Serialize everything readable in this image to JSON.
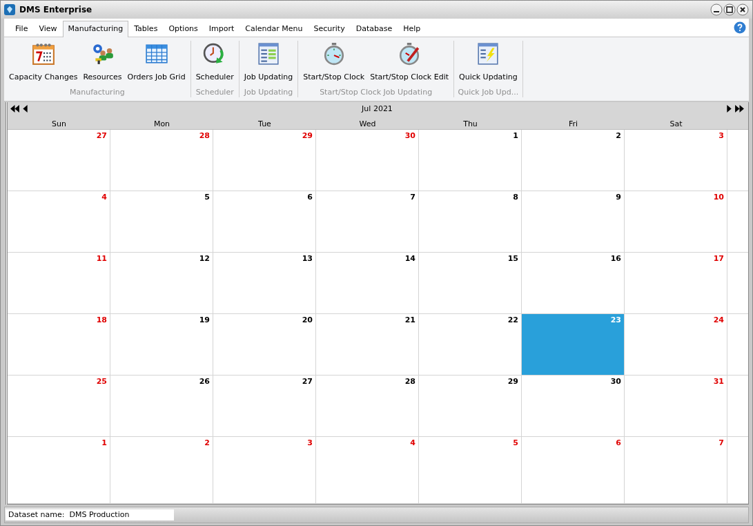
{
  "window": {
    "title": "DMS Enterprise"
  },
  "menu": [
    {
      "label": "File",
      "selected": false
    },
    {
      "label": "View",
      "selected": false
    },
    {
      "label": "Manufacturing",
      "selected": true
    },
    {
      "label": "Tables",
      "selected": false
    },
    {
      "label": "Options",
      "selected": false
    },
    {
      "label": "Import",
      "selected": false
    },
    {
      "label": "Calendar Menu",
      "selected": false
    },
    {
      "label": "Security",
      "selected": false
    },
    {
      "label": "Database",
      "selected": false
    },
    {
      "label": "Help",
      "selected": false
    }
  ],
  "ribbon": [
    {
      "label": "Manufacturing",
      "buttons": [
        {
          "label": "Capacity Changes",
          "kind": "calendar"
        },
        {
          "label": "Resources",
          "kind": "resources"
        },
        {
          "label": "Orders Job Grid",
          "kind": "grid"
        }
      ]
    },
    {
      "label": "Scheduler",
      "buttons": [
        {
          "label": "Scheduler",
          "kind": "scheduler"
        }
      ]
    },
    {
      "label": "Job Updating",
      "buttons": [
        {
          "label": "Job Updating",
          "kind": "form"
        }
      ]
    },
    {
      "label": "Start/Stop Clock Job Updating",
      "buttons": [
        {
          "label": "Start/Stop Clock",
          "kind": "stopwatch"
        },
        {
          "label": "Start/Stop Clock Edit",
          "kind": "stopwatch-edit"
        }
      ]
    },
    {
      "label": "Quick Job Upd...",
      "buttons": [
        {
          "label": "Quick Updating",
          "kind": "quick"
        }
      ]
    }
  ],
  "calendar": {
    "month": "Jul 2021",
    "weekdays": [
      "Sun",
      "Mon",
      "Tue",
      "Wed",
      "Thu",
      "Fri",
      "Sat"
    ],
    "weeks": [
      [
        {
          "day": "27",
          "kind": "red",
          "selected": false
        },
        {
          "day": "28",
          "kind": "red",
          "selected": false
        },
        {
          "day": "29",
          "kind": "red",
          "selected": false
        },
        {
          "day": "30",
          "kind": "red",
          "selected": false
        },
        {
          "day": "1",
          "kind": "normal",
          "selected": false
        },
        {
          "day": "2",
          "kind": "normal",
          "selected": false
        },
        {
          "day": "3",
          "kind": "red",
          "selected": false
        }
      ],
      [
        {
          "day": "4",
          "kind": "red",
          "selected": false
        },
        {
          "day": "5",
          "kind": "normal",
          "selected": false
        },
        {
          "day": "6",
          "kind": "normal",
          "selected": false
        },
        {
          "day": "7",
          "kind": "normal",
          "selected": false
        },
        {
          "day": "8",
          "kind": "normal",
          "selected": false
        },
        {
          "day": "9",
          "kind": "normal",
          "selected": false
        },
        {
          "day": "10",
          "kind": "red",
          "selected": false
        }
      ],
      [
        {
          "day": "11",
          "kind": "red",
          "selected": false
        },
        {
          "day": "12",
          "kind": "normal",
          "selected": false
        },
        {
          "day": "13",
          "kind": "normal",
          "selected": false
        },
        {
          "day": "14",
          "kind": "normal",
          "selected": false
        },
        {
          "day": "15",
          "kind": "normal",
          "selected": false
        },
        {
          "day": "16",
          "kind": "normal",
          "selected": false
        },
        {
          "day": "17",
          "kind": "red",
          "selected": false
        }
      ],
      [
        {
          "day": "18",
          "kind": "red",
          "selected": false
        },
        {
          "day": "19",
          "kind": "normal",
          "selected": false
        },
        {
          "day": "20",
          "kind": "normal",
          "selected": false
        },
        {
          "day": "21",
          "kind": "normal",
          "selected": false
        },
        {
          "day": "22",
          "kind": "normal",
          "selected": false
        },
        {
          "day": "23",
          "kind": "normal",
          "selected": true
        },
        {
          "day": "24",
          "kind": "red",
          "selected": false
        }
      ],
      [
        {
          "day": "25",
          "kind": "red",
          "selected": false
        },
        {
          "day": "26",
          "kind": "normal",
          "selected": false
        },
        {
          "day": "27",
          "kind": "normal",
          "selected": false
        },
        {
          "day": "28",
          "kind": "normal",
          "selected": false
        },
        {
          "day": "29",
          "kind": "normal",
          "selected": false
        },
        {
          "day": "30",
          "kind": "normal",
          "selected": false
        },
        {
          "day": "31",
          "kind": "red",
          "selected": false
        }
      ],
      [
        {
          "day": "1",
          "kind": "red",
          "selected": false
        },
        {
          "day": "2",
          "kind": "red",
          "selected": false
        },
        {
          "day": "3",
          "kind": "red",
          "selected": false
        },
        {
          "day": "4",
          "kind": "red",
          "selected": false
        },
        {
          "day": "5",
          "kind": "red",
          "selected": false
        },
        {
          "day": "6",
          "kind": "red",
          "selected": false
        },
        {
          "day": "7",
          "kind": "red",
          "selected": false
        }
      ]
    ]
  },
  "status_bar": {
    "dataset": "Dataset name:  DMS Production"
  }
}
